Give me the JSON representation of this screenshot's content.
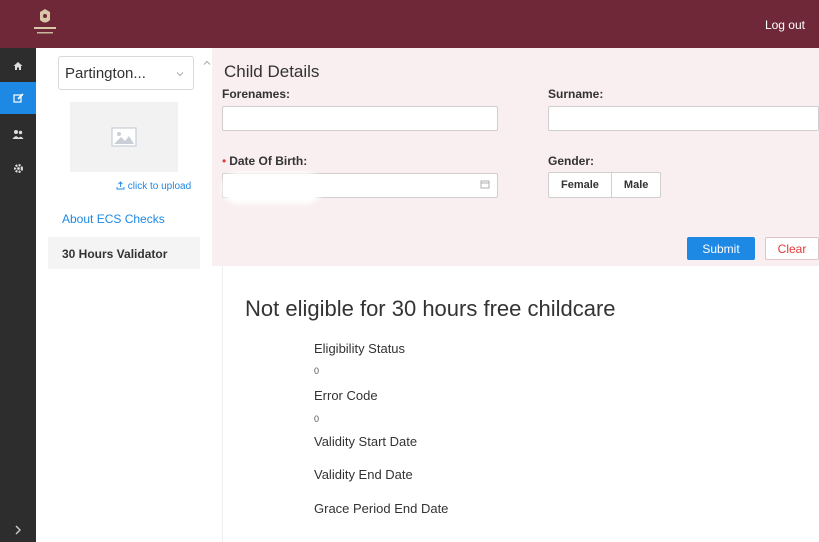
{
  "header": {
    "logout_label": "Log out"
  },
  "sidebar": {
    "icons": [
      "home-icon",
      "edit-icon",
      "users-icon",
      "gear-icon"
    ],
    "active_index": 1
  },
  "leftpanel": {
    "select_value": "Partington...",
    "upload_label": "click to upload",
    "nav": [
      {
        "label": "About ECS Checks",
        "active": false
      },
      {
        "label": "30 Hours Validator",
        "active": true
      }
    ]
  },
  "form": {
    "title": "Child Details",
    "forenames_label": "Forenames:",
    "surname_label": "Surname:",
    "dob_label": "Date Of Birth:",
    "gender_label": "Gender:",
    "gender_options": [
      "Female",
      "Male"
    ],
    "forenames_value": "",
    "surname_value": "",
    "submit_label": "Submit",
    "clear_label": "Clear"
  },
  "results": {
    "title": "Not eligible for 30 hours free childcare",
    "eligibility_status_label": "Eligibility Status",
    "eligibility_status_value": "0",
    "error_code_label": "Error Code",
    "error_code_value": "0",
    "validity_start_label": "Validity Start Date",
    "validity_end_label": "Validity End Date",
    "grace_period_label": "Grace Period End Date"
  },
  "colors": {
    "header": "#6e2838",
    "accent": "#1e88e5",
    "danger": "#e53935",
    "form_bg": "#f9eef0"
  }
}
